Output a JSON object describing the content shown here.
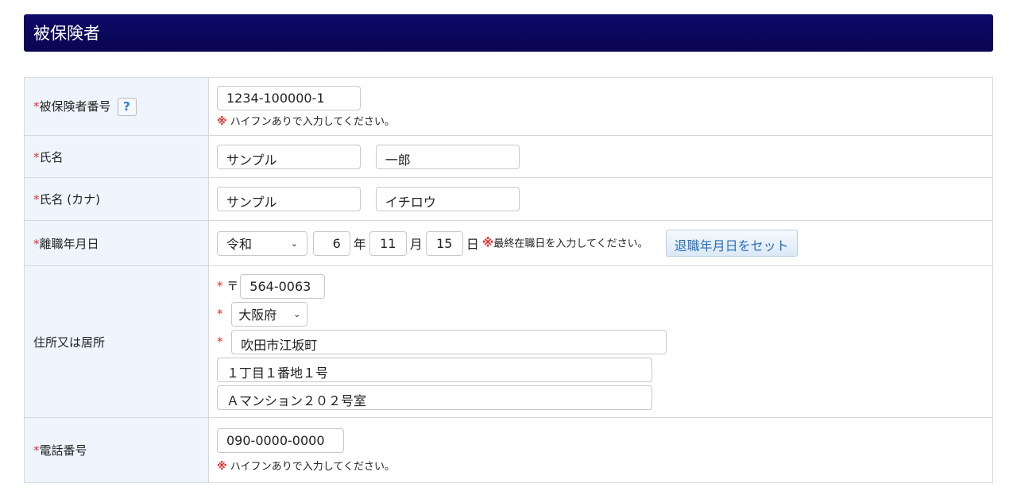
{
  "section_title": "被保険者",
  "required_mark": "*",
  "note_mark": "※",
  "rows": {
    "insured_number": {
      "label": "被保険者番号",
      "help": "?",
      "value": "1234-100000-1",
      "note": "ハイフンありで入力してください。"
    },
    "name": {
      "label": "氏名",
      "last": "サンプル",
      "first": "一郎"
    },
    "name_kana": {
      "label": "氏名 (カナ)",
      "last": "サンプル",
      "first": "イチロウ"
    },
    "retire_date": {
      "label": "離職年月日",
      "era": "令和",
      "year": "6",
      "year_unit": "年",
      "month": "11",
      "month_unit": "月",
      "day": "15",
      "day_unit": "日",
      "note": "最終在職日を入力してください。",
      "set_button": "退職年月日をセット"
    },
    "address": {
      "label": "住所又は居所",
      "postal_mark": "〒",
      "postal": "564-0063",
      "prefecture": "大阪府",
      "line1": "吹田市江坂町",
      "line2": "１丁目１番地１号",
      "line3": "Ａマンション２０２号室"
    },
    "phone": {
      "label": "電話番号",
      "value": "090-0000-0000",
      "note": "ハイフンありで入力してください。"
    }
  }
}
